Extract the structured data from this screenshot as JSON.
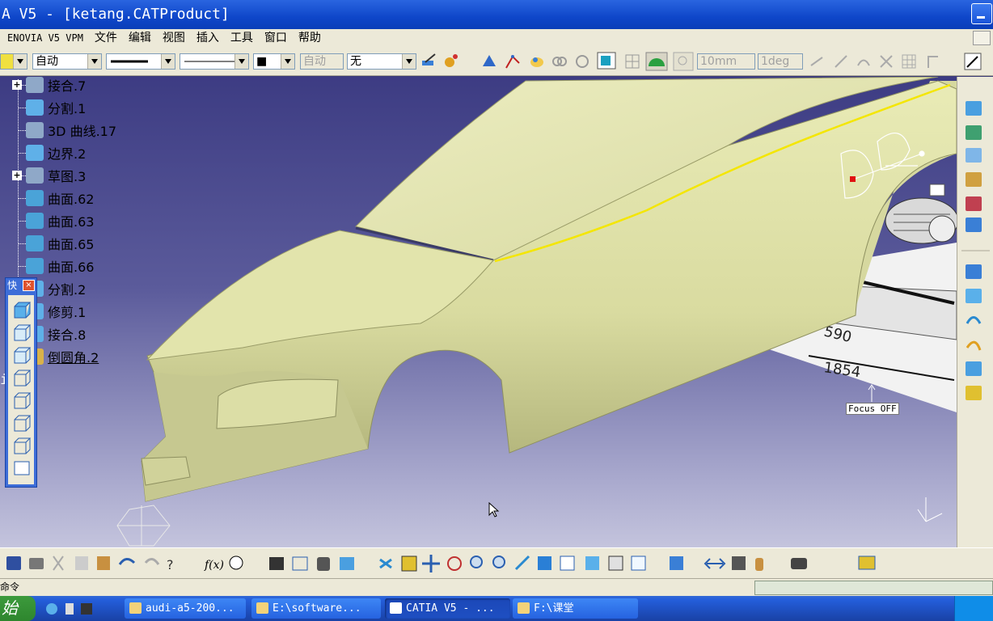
{
  "window": {
    "title": "A V5 - [ketang.CATProduct]"
  },
  "menu": {
    "items": [
      "ENOVIA V5 VPM",
      "文件",
      "编辑",
      "视图",
      "插入",
      "工具",
      "窗口",
      "帮助"
    ]
  },
  "toolbar_top": {
    "color_combo": "",
    "layer_combo": "自动",
    "linetype_combo": "",
    "lineweight_combo": "",
    "point_combo": "■",
    "auto_combo": "自动",
    "none_combo": "无",
    "step_field": "10mm",
    "angle_field": "1deg"
  },
  "tree": {
    "items": [
      {
        "label": "接合.7",
        "icon_color": "#8fa8c8",
        "expandable": true
      },
      {
        "label": "分割.1",
        "icon_color": "#5fb0e8",
        "expandable": false
      },
      {
        "label": "3D 曲线.17",
        "icon_color": "#8fa8c8",
        "expandable": false
      },
      {
        "label": "边界.2",
        "icon_color": "#5fb0e8",
        "expandable": false
      },
      {
        "label": "草图.3",
        "icon_color": "#8fa8c8",
        "expandable": true
      },
      {
        "label": "曲面.62",
        "icon_color": "#4aa3d8",
        "expandable": false
      },
      {
        "label": "曲面.63",
        "icon_color": "#4aa3d8",
        "expandable": false
      },
      {
        "label": "曲面.65",
        "icon_color": "#4aa3d8",
        "expandable": false
      },
      {
        "label": "曲面.66",
        "icon_color": "#4aa3d8",
        "expandable": false
      },
      {
        "label": "分割.2",
        "icon_color": "#5fb0e8",
        "expandable": false
      },
      {
        "label": "修剪.1",
        "icon_color": "#5fb0e8",
        "expandable": false
      },
      {
        "label": "接合.8",
        "icon_color": "#5fb0e8",
        "expandable": false
      },
      {
        "label": "倒圆角.2",
        "icon_color": "#d9b24a",
        "expandable": false,
        "selected": true
      }
    ],
    "applications_label": "ions"
  },
  "quick_panel": {
    "title": "快",
    "close": "×"
  },
  "viewport": {
    "focus_label": "Focus OFF",
    "dimension_1": "1854",
    "dimension_2": "590"
  },
  "statusbar": {
    "command_label": "命令"
  },
  "taskbar": {
    "start_label": "始",
    "tasks": [
      {
        "label": "audi-a5-200..."
      },
      {
        "label": "E:\\software..."
      },
      {
        "label": "CATIA V5 - ..."
      },
      {
        "label": "F:\\课堂"
      }
    ]
  },
  "colors": {
    "body_surface": "#e3e3a8",
    "feature_curve": "#f4e600",
    "title_bar": "#0e46c9",
    "viewport_top": "#3d3c83"
  }
}
